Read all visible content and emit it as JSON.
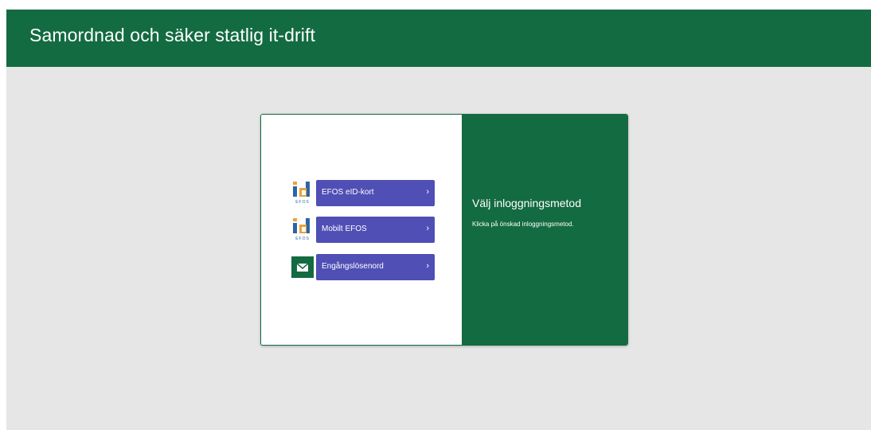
{
  "header": {
    "title": "Samordnad och säker statlig it-drift"
  },
  "login": {
    "methods": [
      {
        "label": "EFOS eID-kort",
        "icon": "efos-id-logo-icon"
      },
      {
        "label": "Mobilt EFOS",
        "icon": "efos-id-logo-icon"
      },
      {
        "label": "Engångslösenord",
        "icon": "envelope-icon"
      }
    ],
    "icon_text": {
      "id": "id",
      "efos": "EFOS"
    },
    "chevron": "›",
    "panel_title": "Välj inloggningsmetod",
    "panel_description": "Klicka på önskad inloggningsmetod."
  },
  "colors": {
    "brand_green": "#136b41",
    "button_purple": "#4f4fb5",
    "background_gray": "#e6e6e6",
    "logo_orange": "#e8a33a",
    "logo_blue": "#2f63a8"
  }
}
